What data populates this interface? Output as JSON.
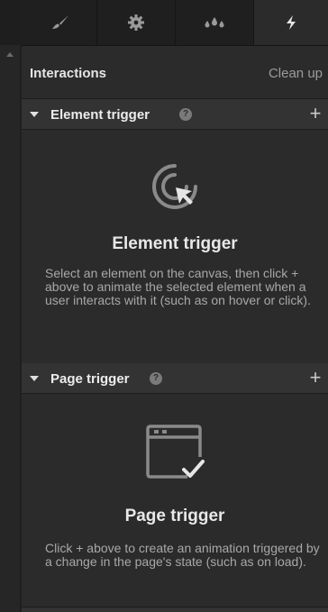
{
  "tabs": [
    {
      "name": "style",
      "icon": "paintbrush-icon"
    },
    {
      "name": "settings",
      "icon": "gear-icon"
    },
    {
      "name": "style-manager",
      "icon": "droplets-icon"
    },
    {
      "name": "interactions",
      "icon": "lightning-icon",
      "active": true
    }
  ],
  "interactions": {
    "title": "Interactions",
    "cleanup_label": "Clean up"
  },
  "element_trigger": {
    "header": "Element trigger",
    "empty_title": "Element trigger",
    "empty_desc": "Select an element on the canvas, then click + above to animate the selected element when a user interacts with it (such as on hover or click)."
  },
  "page_trigger": {
    "header": "Page trigger",
    "empty_title": "Page trigger",
    "empty_desc": "Click + above to create an animation triggered by a change in the page's state (such as on load)."
  },
  "colors": {
    "panel_bg": "#2b2b2b",
    "tabbar_bg": "#1f1f1f",
    "section_bg": "#333333",
    "text_primary": "#e8e8e8",
    "text_secondary": "#a8a8a8",
    "icon_muted": "#7a7a7a"
  }
}
